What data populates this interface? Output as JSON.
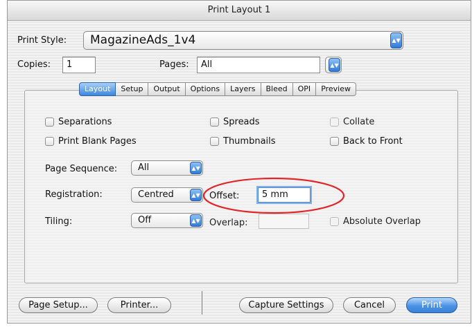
{
  "window": {
    "title": "Print Layout 1"
  },
  "print_style": {
    "label": "Print Style:",
    "value": "MagazineAds_1v4"
  },
  "copies": {
    "label": "Copies:",
    "value": "1"
  },
  "pages": {
    "label": "Pages:",
    "value": "All"
  },
  "tabs": [
    "Layout",
    "Setup",
    "Output",
    "Options",
    "Layers",
    "Bleed",
    "OPI",
    "Preview"
  ],
  "active_tab": "Layout",
  "checkboxes": {
    "separations": "Separations",
    "spreads": "Spreads",
    "collate": "Collate",
    "print_blank_pages": "Print Blank Pages",
    "thumbnails": "Thumbnails",
    "back_to_front": "Back to Front",
    "absolute_overlap": "Absolute Overlap"
  },
  "page_sequence": {
    "label": "Page Sequence:",
    "value": "All"
  },
  "registration": {
    "label": "Registration:",
    "value": "Centred"
  },
  "offset": {
    "label": "Offset:",
    "value": "5 mm"
  },
  "tiling": {
    "label": "Tiling:",
    "value": "Off"
  },
  "overlap": {
    "label": "Overlap:",
    "value": ""
  },
  "buttons": {
    "page_setup": "Page Setup...",
    "printer": "Printer...",
    "capture_settings": "Capture Settings",
    "cancel": "Cancel",
    "print": "Print"
  },
  "colors": {
    "highlight_ellipse": "#e0262a",
    "accent": "#3a82d6"
  }
}
